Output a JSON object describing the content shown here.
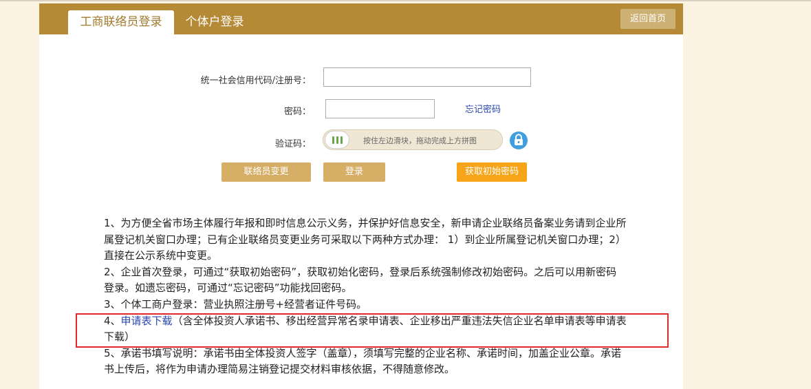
{
  "tabs": [
    {
      "label": "工商联络员登录",
      "active": true
    },
    {
      "label": "个体户登录",
      "active": false
    }
  ],
  "header": {
    "home_label": "返回首页",
    "bg_color": "#b58a36"
  },
  "form": {
    "code_label": "统一社会信用代码/注册号：",
    "code_value": "",
    "password_label": "密码：",
    "password_value": "",
    "forgot_label": "忘记密码",
    "captcha_label": "验证码：",
    "slider_hint": "按住左边滑块，拖动完成上方拼图",
    "lock_icon": "lock-icon"
  },
  "buttons": {
    "change_contact": "联络员变更",
    "login": "登录",
    "get_initial_password": "获取初始密码"
  },
  "notes": {
    "n1": "1、为方便全省市场主体履行年报和即时信息公示义务，并保护好信息安全，新申请企业联络员备案业务请到企业所属登记机关窗口办理；已有企业联络员变更业务可采取以下两种方式办理： 1）到企业所属登记机关窗口办理；2）直接在公示系统中变更。",
    "n2": "2、企业首次登录，可通过“获取初始密码”，获取初始化密码，登录后系统强制修改初始密码。之后可以用新密码登录。如遗忘密码，可通过“忘记密码”功能找回密码。",
    "n3": "3、个体工商户登录：营业执照注册号+经营者证件号码。",
    "n4_prefix": "4、",
    "n4_link": "申请表下载",
    "n4_rest": "（含全体投资人承诺书、移出经营异常名录申请表、企业移出严重违法失信企业名单申请表等申请表下载）",
    "n5": "5、承诺书填写说明：承诺书由全体投资人签字（盖章），须填写完整的企业名称、承诺时间，加盖企业公章。承诺书上传后，将作为申请办理简易注销登记提交材料审核依据，不得随意修改。"
  },
  "colors": {
    "accent": "#b58a36",
    "button": "#d6ae66",
    "orange": "#f6a418",
    "link": "#2a46b0",
    "highlight": "#e02a2a"
  }
}
